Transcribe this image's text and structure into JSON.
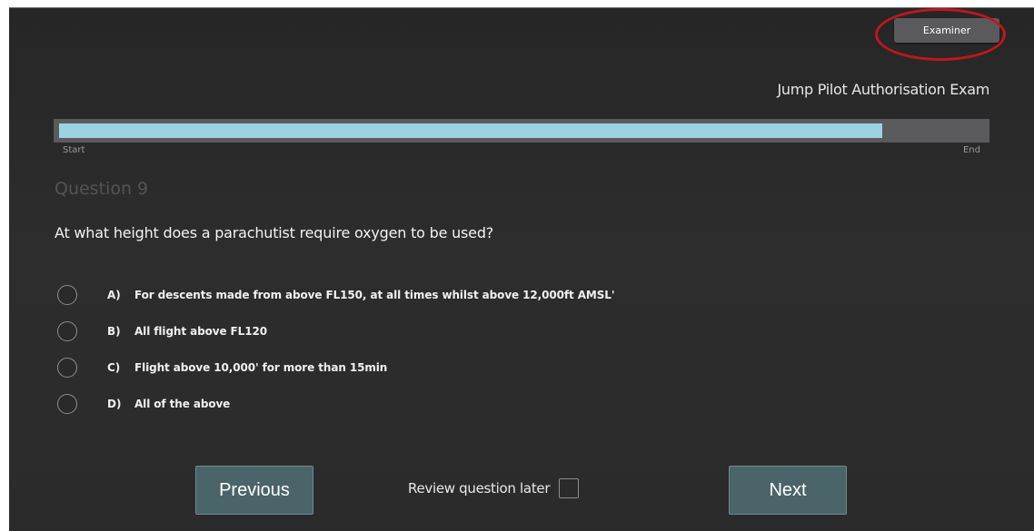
{
  "header": {
    "examiner_label": "Examiner",
    "exam_title": "Jump Pilot Authorisation Exam"
  },
  "progress": {
    "start_label": "Start",
    "end_label": "End",
    "fraction": 0.89
  },
  "question": {
    "number_label": "Question 9",
    "text": "At what height does a parachutist require oxygen to be used?",
    "options": [
      {
        "letter": "A)",
        "text": "For descents made from above FL150, at all times whilst above 12,000ft AMSL'"
      },
      {
        "letter": "B)",
        "text": "All flight above FL120"
      },
      {
        "letter": "C)",
        "text": "Flight above 10,000' for more than 15min"
      },
      {
        "letter": "D)",
        "text": "All of the above"
      }
    ]
  },
  "footer": {
    "previous_label": "Previous",
    "review_label": "Review question later",
    "next_label": "Next"
  },
  "colors": {
    "progress_fill": "#9dd2e3",
    "highlight_ring": "#c0161c",
    "nav_button": "#4b6469"
  }
}
